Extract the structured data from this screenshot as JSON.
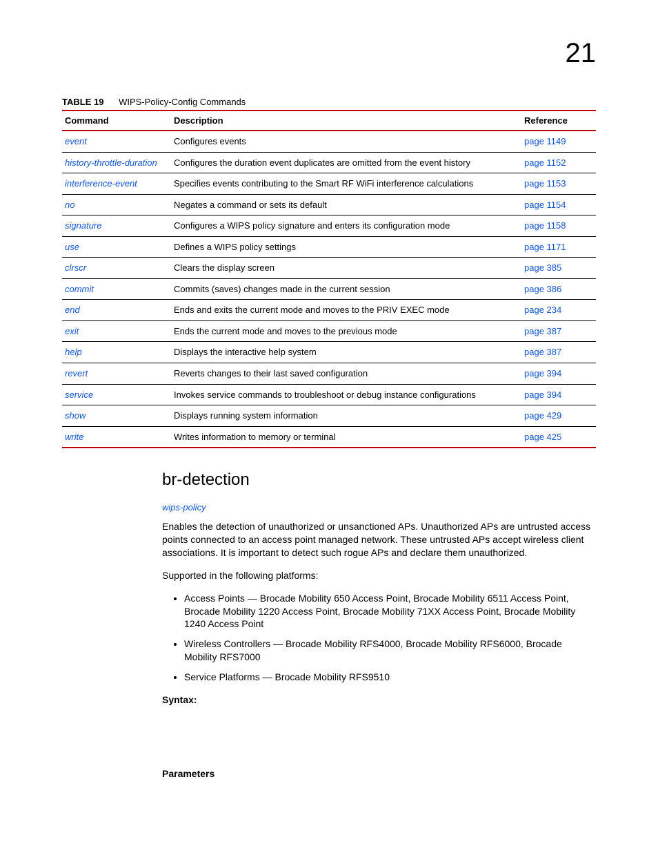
{
  "chapterNumber": "21",
  "table": {
    "label": "TABLE 19",
    "title": "WIPS-Policy-Config Commands",
    "headers": {
      "command": "Command",
      "description": "Description",
      "reference": "Reference"
    },
    "rows": [
      {
        "cmd": "event",
        "desc": "Configures events",
        "ref": "page 1149"
      },
      {
        "cmd": "history-throttle-duration",
        "desc": "Configures the duration event duplicates are omitted from the event history",
        "ref": "page 1152"
      },
      {
        "cmd": "interference-event",
        "desc": "Specifies events contributing to the Smart RF WiFi interference calculations",
        "ref": "page 1153"
      },
      {
        "cmd": "no",
        "desc": "Negates a command or sets its default",
        "ref": "page 1154"
      },
      {
        "cmd": "signature",
        "desc": "Configures a WIPS policy signature and enters its configuration mode",
        "ref": "page 1158"
      },
      {
        "cmd": "use",
        "desc": "Defines a WIPS policy settings",
        "ref": "page 1171"
      },
      {
        "cmd": "clrscr",
        "desc": "Clears the display screen",
        "ref": "page 385"
      },
      {
        "cmd": "commit",
        "desc": "Commits (saves) changes made in the current session",
        "ref": "page 386"
      },
      {
        "cmd": "end",
        "desc": "Ends and exits the current mode and moves to the PRIV EXEC mode",
        "ref": "page 234"
      },
      {
        "cmd": "exit",
        "desc": "Ends the current mode and moves to the previous mode",
        "ref": "page 387"
      },
      {
        "cmd": "help",
        "desc": "Displays the interactive help system",
        "ref": "page 387"
      },
      {
        "cmd": "revert",
        "desc": "Reverts changes to their last saved configuration",
        "ref": "page 394"
      },
      {
        "cmd": "service",
        "desc": "Invokes service commands to troubleshoot or debug instance configurations",
        "ref": "page 394"
      },
      {
        "cmd": "show",
        "desc": "Displays running system information",
        "ref": "page 429"
      },
      {
        "cmd": "write",
        "desc": "Writes information to memory or terminal",
        "ref": "page 425"
      }
    ]
  },
  "section": {
    "title": "br-detection",
    "contextLink": "wips-policy",
    "description": "Enables the detection of unauthorized or unsanctioned APs. Unauthorized APs are untrusted access points connected to an access point managed network. These untrusted APs accept wireless client associations. It is important to detect such rogue APs and declare them unauthorized.",
    "supportedLabel": "Supported in the following platforms:",
    "platforms": [
      "Access Points — Brocade Mobility 650 Access Point, Brocade Mobility 6511 Access Point, Brocade Mobility 1220 Access Point, Brocade Mobility 71XX Access Point, Brocade Mobility 1240 Access Point",
      "Wireless Controllers — Brocade Mobility RFS4000, Brocade Mobility RFS6000, Brocade Mobility RFS7000",
      "Service Platforms — Brocade Mobility RFS9510"
    ],
    "syntaxLabel": "Syntax:",
    "parametersLabel": "Parameters"
  }
}
